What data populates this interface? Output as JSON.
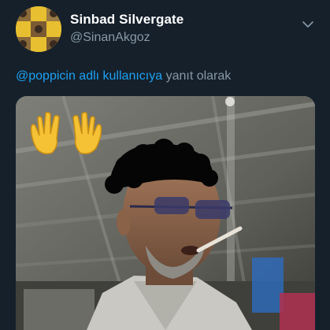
{
  "tweet": {
    "display_name": "Sinbad Silvergate",
    "handle": "@SinanAkgoz",
    "menu_icon": "chevron-down-icon",
    "reply_context": {
      "mention": "@poppicin adlı kullanıcıya",
      "suffix": " yanıt olarak"
    },
    "media": {
      "description_icon": "photo",
      "emoji": "waving-hands-emoji"
    }
  },
  "colors": {
    "background": "#15202b",
    "name": "#ffffff",
    "secondary_text": "#8899a6",
    "link": "#1da1f2",
    "emoji": "#f5c235"
  }
}
